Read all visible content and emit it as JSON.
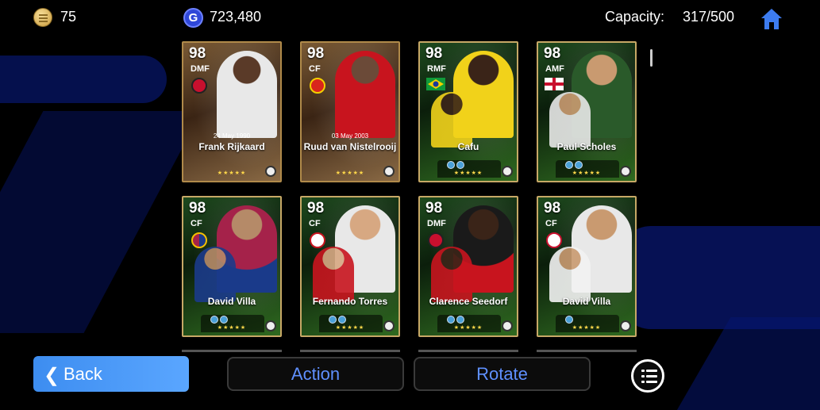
{
  "header": {
    "coins": "75",
    "gp_icon": "G",
    "gp": "723,480",
    "capacity_label": "Capacity:",
    "capacity_value": "317/500"
  },
  "cards": [
    {
      "rating": "98",
      "position": "DMF",
      "date": "24 May 1990",
      "name": "Frank Rijkaard",
      "style": "gold"
    },
    {
      "rating": "98",
      "position": "CF",
      "date": "03 May 2003",
      "name": "Ruud van Nistelrooij",
      "style": "gold"
    },
    {
      "rating": "98",
      "position": "RMF",
      "date": "",
      "name": "Cafu",
      "style": "green"
    },
    {
      "rating": "98",
      "position": "AMF",
      "date": "",
      "name": "Paul Scholes",
      "style": "green"
    },
    {
      "rating": "98",
      "position": "CF",
      "date": "",
      "name": "David Villa",
      "style": "green"
    },
    {
      "rating": "98",
      "position": "CF",
      "date": "",
      "name": "Fernando Torres",
      "style": "green"
    },
    {
      "rating": "98",
      "position": "DMF",
      "date": "",
      "name": "Clarence Seedorf",
      "style": "green"
    },
    {
      "rating": "98",
      "position": "CF",
      "date": "",
      "name": "David Villa",
      "style": "green"
    }
  ],
  "buttons": {
    "back": "Back",
    "action": "Action",
    "rotate": "Rotate"
  },
  "icons": {
    "coin": "coin-icon",
    "gp": "gp-icon",
    "home": "home-icon",
    "menu": "list-menu-icon",
    "back": "chevron-left-icon"
  },
  "colors": {
    "accent": "#5f90ff",
    "back_button": "#4a98f8",
    "home": "#3d7cf0"
  }
}
